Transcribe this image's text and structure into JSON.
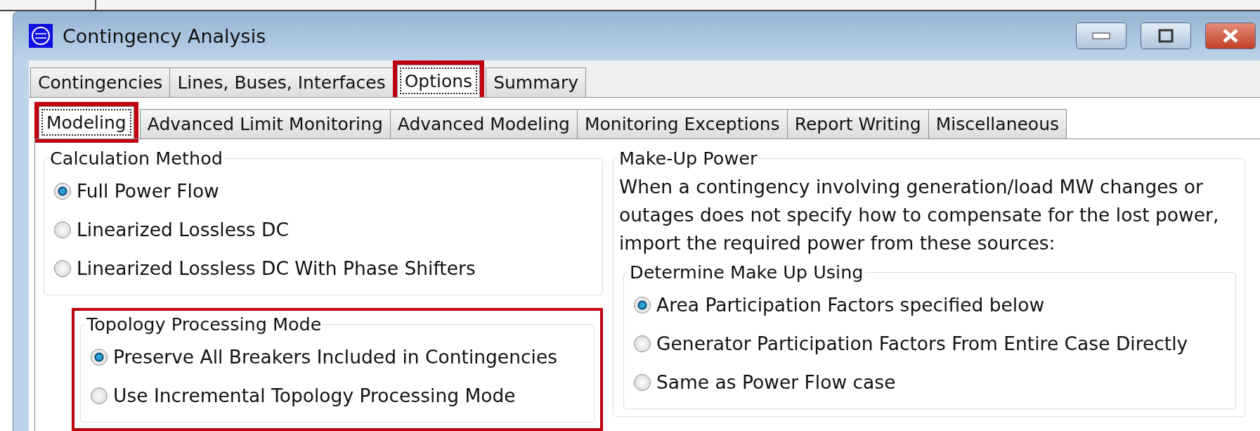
{
  "window": {
    "title": "Contingency Analysis"
  },
  "tabs": [
    {
      "label": "Contingencies",
      "selected": false,
      "highlighted": false
    },
    {
      "label": "Lines, Buses, Interfaces",
      "selected": false,
      "highlighted": false
    },
    {
      "label": "Options",
      "selected": true,
      "highlighted": true
    },
    {
      "label": "Summary",
      "selected": false,
      "highlighted": false
    }
  ],
  "subtabs": [
    {
      "label": "Modeling",
      "selected": true,
      "highlighted": true
    },
    {
      "label": "Advanced Limit Monitoring",
      "selected": false,
      "highlighted": false
    },
    {
      "label": "Advanced Modeling",
      "selected": false,
      "highlighted": false
    },
    {
      "label": "Monitoring Exceptions",
      "selected": false,
      "highlighted": false
    },
    {
      "label": "Report Writing",
      "selected": false,
      "highlighted": false
    },
    {
      "label": "Miscellaneous",
      "selected": false,
      "highlighted": false
    }
  ],
  "calculation_method": {
    "title": "Calculation Method",
    "options": [
      {
        "label": "Full Power Flow",
        "selected": true
      },
      {
        "label": "Linearized Lossless DC",
        "selected": false
      },
      {
        "label": "Linearized Lossless DC With Phase Shifters",
        "selected": false
      }
    ]
  },
  "topology_processing_mode": {
    "title": "Topology Processing Mode",
    "highlighted": true,
    "options": [
      {
        "label": "Preserve All Breakers Included in Contingencies",
        "selected": true
      },
      {
        "label": "Use Incremental Topology Processing Mode",
        "selected": false
      }
    ]
  },
  "make_up_power": {
    "title": "Make-Up Power",
    "description": "When a contingency involving generation/load MW changes or outages  does not specify how to compensate for the lost power, import the required power from these sources:",
    "determine": {
      "title": "Determine Make Up Using",
      "options": [
        {
          "label": "Area Participation Factors specified below",
          "selected": true
        },
        {
          "label": "Generator Participation Factors From Entire Case Directly",
          "selected": false
        },
        {
          "label": "Same as Power Flow case",
          "selected": false
        }
      ]
    }
  }
}
